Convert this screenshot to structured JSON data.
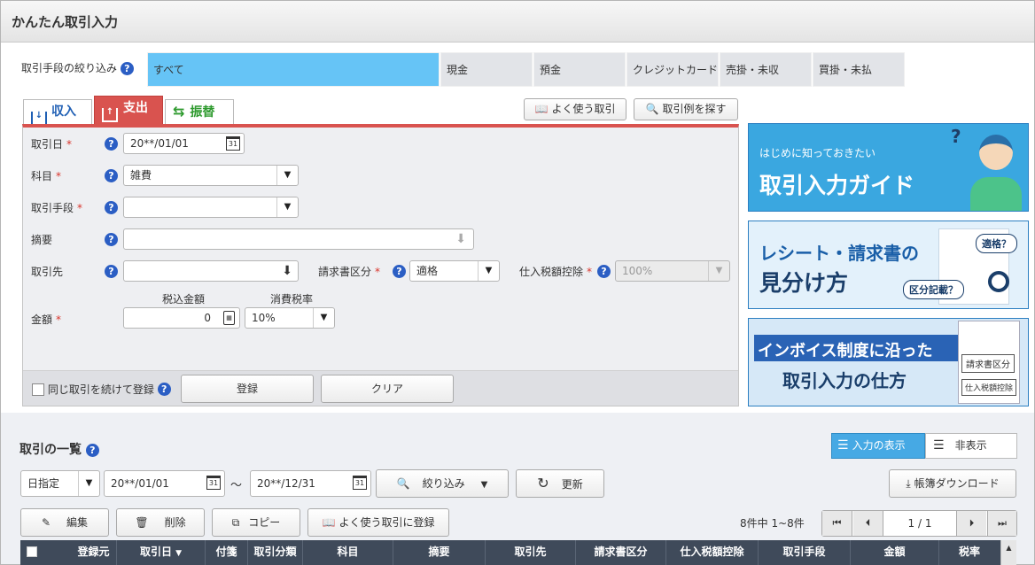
{
  "app": {
    "title": "かんたん取引入力"
  },
  "filter": {
    "label": "取引手段の絞り込み",
    "options": [
      "すべて",
      "現金",
      "預金",
      "クレジットカード",
      "売掛・未収",
      "買掛・未払"
    ],
    "active": "すべて"
  },
  "tabs": {
    "income": "収入",
    "expense": "支出",
    "transfer": "振替",
    "active": "支出"
  },
  "toolbar": {
    "favorites": "よく使う取引",
    "examples": "取引例を探す"
  },
  "form": {
    "date_label": "取引日",
    "date_value": "20**/01/01",
    "account_label": "科目",
    "account_value": "雑費",
    "method_label": "取引手段",
    "method_value": "",
    "memo_label": "摘要",
    "memo_value": "",
    "partner_label": "取引先",
    "partner_value": "",
    "invoice_label": "請求書区分",
    "invoice_value": "適格",
    "deduction_label": "仕入税額控除",
    "deduction_value": "100%",
    "amount_header": "税込金額",
    "taxrate_header": "消費税率",
    "amount_label": "金額",
    "amount_value": "0",
    "taxrate_value": "10%",
    "required_mark": "*",
    "repeat_label": "同じ取引を続けて登録",
    "register": "登録",
    "clear": "クリア"
  },
  "banners": {
    "guide_sub": "はじめに知っておきたい",
    "guide_title": "取引入力ガイド",
    "receipt_title1": "レシート・請求書の",
    "receipt_title2": "見分け方",
    "receipt_bubble1": "適格？",
    "receipt_bubble2": "区分記載？",
    "invoice_title1": "インボイス制度に沿った",
    "invoice_title2": "取引入力の仕方",
    "invoice_tag1": "請求書区分",
    "invoice_tag2": "仕入税額控除"
  },
  "list": {
    "title": "取引の一覧",
    "show_input": "入力の表示",
    "hide": "非表示",
    "date_mode": "日指定",
    "from": "20**/01/01",
    "tilde": "～",
    "to": "20**/12/31",
    "narrow": "絞り込み",
    "refresh": "更新",
    "download": "帳簿ダウンロード",
    "edit": "編集",
    "delete": "削除",
    "copy": "コピー",
    "add_favorite": "よく使う取引に登録",
    "count": "8件中 1~8件",
    "page": "1",
    "page_sep": "/",
    "pages": "1",
    "columns": [
      "登録元",
      "取引日",
      "付箋",
      "取引分類",
      "科目",
      "摘要",
      "取引先",
      "請求書区分",
      "仕入税額控除",
      "取引手段",
      "金額",
      "税率"
    ]
  },
  "colors": {
    "accent": "#66c4f6",
    "expense_red": "#d9534f",
    "header_dark": "#3f4a5a"
  }
}
